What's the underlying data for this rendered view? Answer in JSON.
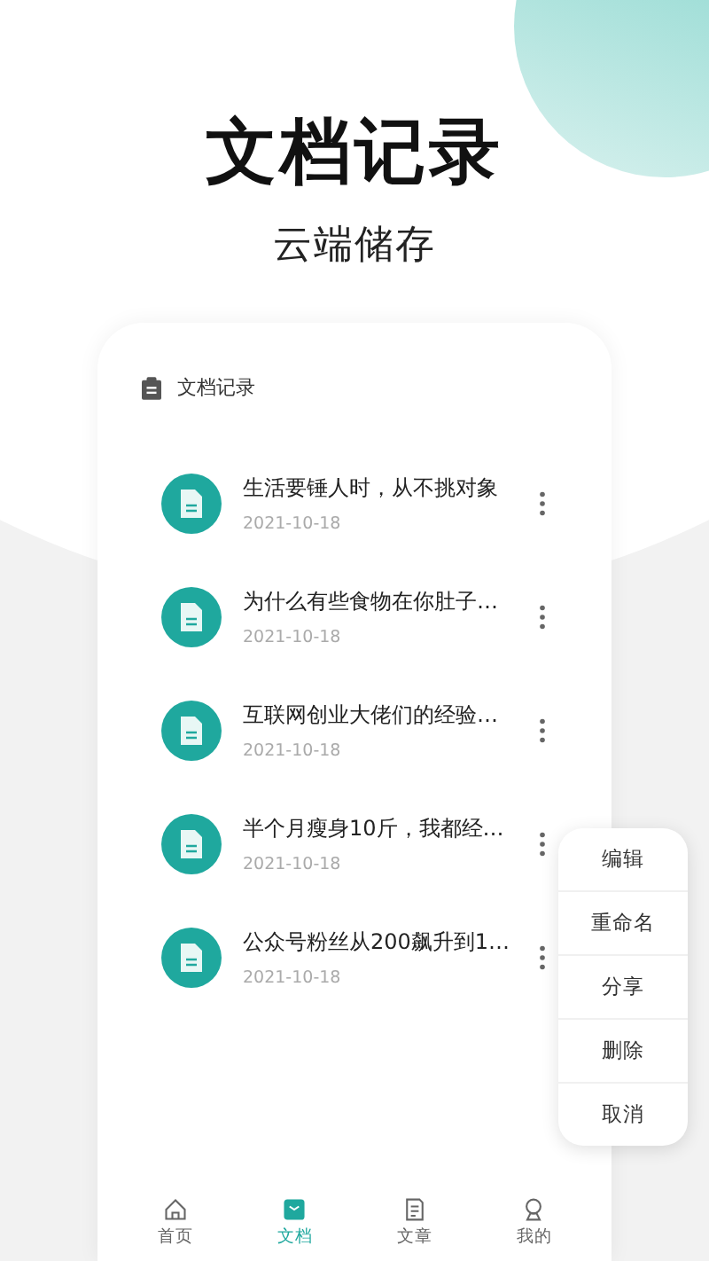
{
  "headline": "文档记录",
  "subheadline": "云端储存",
  "card_title": "文档记录",
  "documents": [
    {
      "title": "生活要锤人时，从不挑对象",
      "date": "2021-10-18"
    },
    {
      "title": "为什么有些食物在你肚子…",
      "date": "2021-10-18"
    },
    {
      "title": "互联网创业大佬们的经验…",
      "date": "2021-10-18"
    },
    {
      "title": "半个月瘦身10斤，我都经…",
      "date": "2021-10-18"
    },
    {
      "title": "公众号粉丝从200飙升到1…",
      "date": "2021-10-18"
    }
  ],
  "context_menu": [
    "编辑",
    "重命名",
    "分享",
    "删除",
    "取消"
  ],
  "tabs": [
    {
      "label": "首页",
      "kind": "home",
      "selected": false
    },
    {
      "label": "文档",
      "kind": "docs",
      "selected": true
    },
    {
      "label": "文章",
      "kind": "article",
      "selected": false
    },
    {
      "label": "我的",
      "kind": "me",
      "selected": false
    }
  ]
}
